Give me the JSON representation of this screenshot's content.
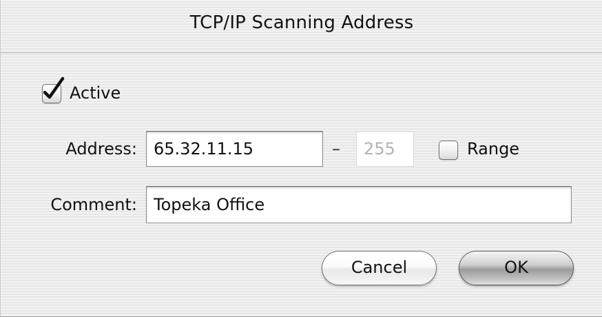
{
  "dialog": {
    "title": "TCP/IP Scanning Address"
  },
  "active": {
    "label": "Active",
    "checked": true
  },
  "address": {
    "label": "Address:",
    "value": "65.32.11.15",
    "separator": "–",
    "range_end": "255"
  },
  "range": {
    "label": "Range",
    "checked": false
  },
  "comment": {
    "label": "Comment:",
    "value": "Topeka Office"
  },
  "buttons": {
    "cancel_label": "Cancel",
    "ok_label": "OK"
  },
  "icons": {
    "active_check": "checkmark-icon"
  }
}
